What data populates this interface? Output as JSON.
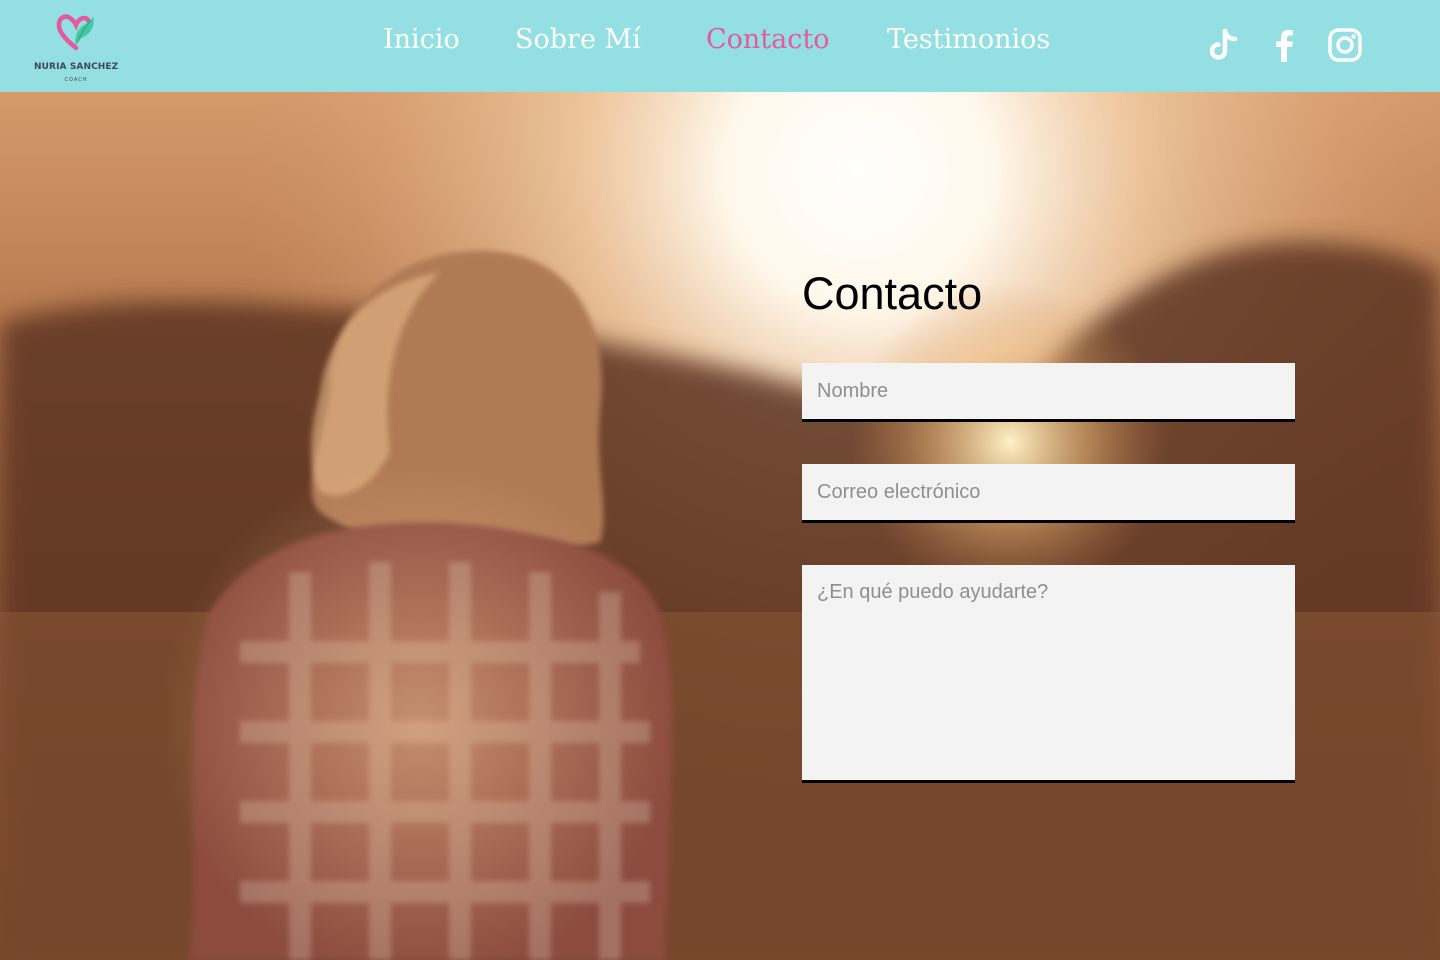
{
  "brand": {
    "name": "NURIA SANCHEZ",
    "tagline": "COACH"
  },
  "nav": {
    "items": [
      {
        "label": "Inicio"
      },
      {
        "label": "Sobre Mí"
      },
      {
        "label": "Contacto",
        "active": true
      },
      {
        "label": "Testimonios"
      }
    ]
  },
  "social": [
    "tiktok-icon",
    "facebook-icon",
    "instagram-icon"
  ],
  "contact": {
    "title": "Contacto",
    "name_placeholder": "Nombre",
    "email_placeholder": "Correo electrónico",
    "message_placeholder": "¿En qué puedo ayudarte?"
  },
  "colors": {
    "header_bg": "#94dfe2",
    "nav_active": "#e45aa1",
    "nav_text": "#ffffff",
    "field_bg": "#f3f3f3"
  }
}
